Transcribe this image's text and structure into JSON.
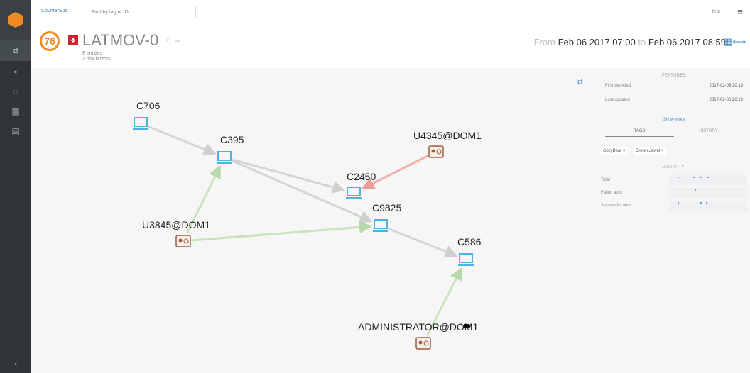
{
  "app": {
    "brand": "CounterSpa",
    "search_placeholder": "Find by tag or ID",
    "user": "test"
  },
  "header": {
    "score": "76",
    "title": "LATMOV-0",
    "title_suffix": "–",
    "entities": "8 entities",
    "risk_factors": "3 risk factors",
    "range_from_word": "From",
    "range_from": "Feb 06 2017 07:00",
    "range_to_word": "to",
    "range_to": "Feb 06 2017 08:59"
  },
  "graph": {
    "nodes": [
      {
        "id": "C706",
        "label": "C706",
        "kind": "computer"
      },
      {
        "id": "C395",
        "label": "C395",
        "kind": "computer"
      },
      {
        "id": "U4345",
        "label": "U4345@DOM1",
        "kind": "user"
      },
      {
        "id": "C2450",
        "label": "C2450",
        "kind": "computer"
      },
      {
        "id": "C9825",
        "label": "C9825",
        "kind": "computer"
      },
      {
        "id": "U3845",
        "label": "U3845@DOM1",
        "kind": "user"
      },
      {
        "id": "C586",
        "label": "C586",
        "kind": "computer"
      },
      {
        "id": "ADMIN",
        "label": "ADMINISTRATOR@DOM1",
        "kind": "user",
        "tagged": true
      }
    ],
    "edges": [
      {
        "from": "C706",
        "to": "C395",
        "color": "gray"
      },
      {
        "from": "C395",
        "to": "C2450",
        "color": "gray"
      },
      {
        "from": "C395",
        "to": "C9825",
        "color": "gray"
      },
      {
        "from": "U4345",
        "to": "C2450",
        "color": "red"
      },
      {
        "from": "U3845",
        "to": "C395",
        "color": "green"
      },
      {
        "from": "U3845",
        "to": "C9825",
        "color": "green"
      },
      {
        "from": "C9825",
        "to": "C586",
        "color": "gray"
      },
      {
        "from": "ADMIN",
        "to": "C586",
        "color": "green"
      }
    ]
  },
  "panel": {
    "features_heading": "FEATURES",
    "first_detected_label": "First detected",
    "first_detected_value": "2017-02-06 20:19",
    "last_updated_label": "Last updated",
    "last_updated_value": "2017-02-06 20:19",
    "show_more": "Show more",
    "tab_tags": "TAGS",
    "tab_history": "HISTORY",
    "tags": [
      "CozyBear",
      "Crown.Jewel"
    ],
    "activity_heading": "ACTIVITY",
    "activity_rows": [
      {
        "label": "Total"
      },
      {
        "label": "Failed auth"
      },
      {
        "label": "Successful auth"
      }
    ]
  },
  "colors": {
    "accent": "#3d86c6",
    "score": "#f08a24",
    "flag": "#d0222e",
    "computer": "#4fb3dd",
    "user": "#9b5b3d",
    "edge_gray": "#d4d4d4",
    "edge_red": "#efb0ae",
    "edge_green": "#c9e3bd"
  }
}
